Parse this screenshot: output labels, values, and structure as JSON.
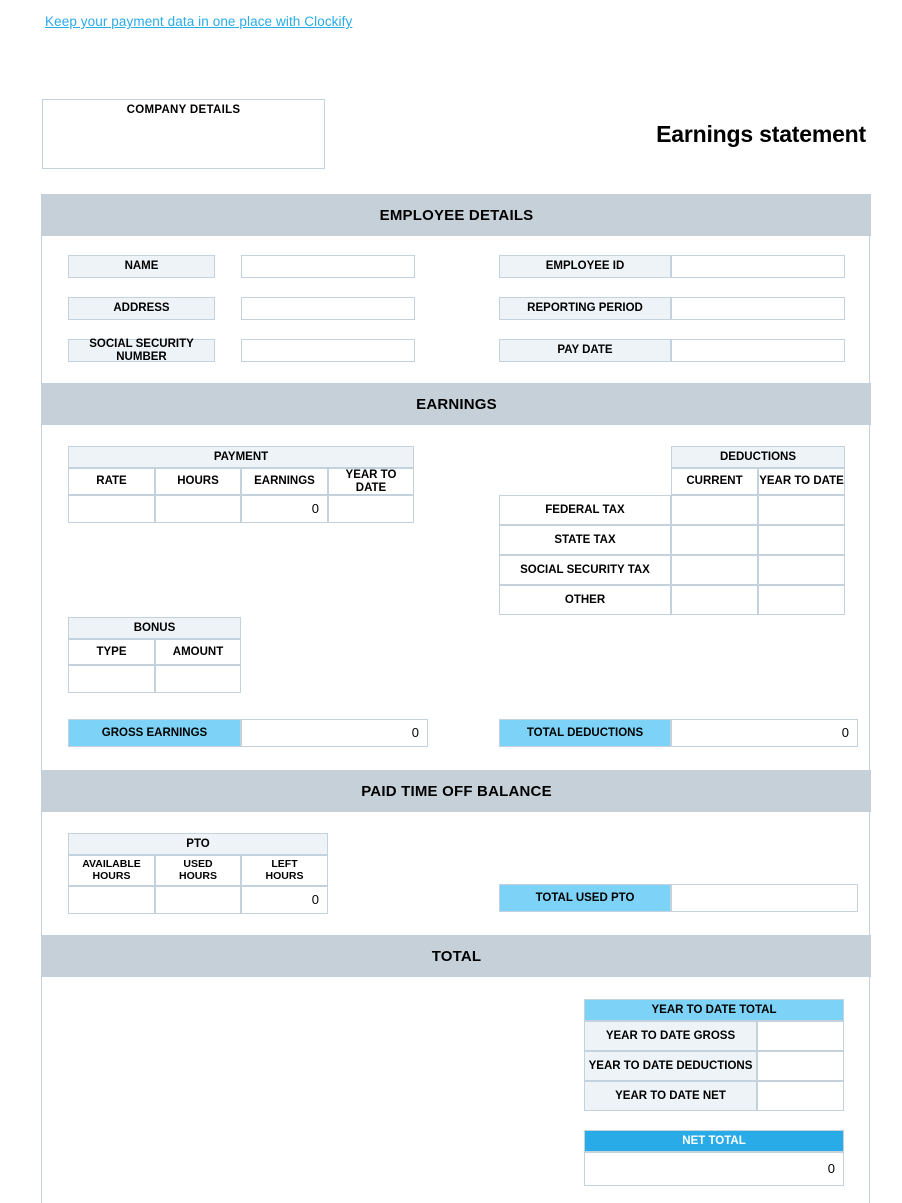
{
  "promo": {
    "link_text": "Keep your payment data in one place with Clockify"
  },
  "header": {
    "company_details_label": "COMPANY DETAILS",
    "title": "Earnings statement"
  },
  "colors": {
    "band": "#c5d0d8",
    "label_fill": "#edf3f7",
    "accent_light": "#7dd3f7",
    "accent_strong": "#29abe8",
    "link": "#29abe8",
    "border": "#c3d2dc"
  },
  "sections": {
    "employee_details": "EMPLOYEE DETAILS",
    "earnings": "EARNINGS",
    "pto_balance": "PAID TIME OFF BALANCE",
    "total": "TOTAL"
  },
  "employee_details": {
    "left_fields": [
      {
        "label": "NAME",
        "value": ""
      },
      {
        "label": "ADDRESS",
        "value": ""
      },
      {
        "label": "SOCIAL SECURITY NUMBER",
        "value": ""
      }
    ],
    "right_fields": [
      {
        "label": "EMPLOYEE ID",
        "value": ""
      },
      {
        "label": "REPORTING PERIOD",
        "value": ""
      },
      {
        "label": "PAY DATE",
        "value": ""
      }
    ]
  },
  "payment_table": {
    "title": "PAYMENT",
    "columns": [
      "RATE",
      "HOURS",
      "EARNINGS",
      "YEAR TO DATE"
    ],
    "rows": [
      {
        "rate": "",
        "hours": "",
        "earnings": "0",
        "year_to_date": ""
      }
    ]
  },
  "deductions_table": {
    "title": "DEDUCTIONS",
    "columns": [
      "CURRENT",
      "YEAR TO DATE"
    ],
    "rows": [
      {
        "label": "FEDERAL TAX",
        "current": "",
        "year_to_date": ""
      },
      {
        "label": "STATE TAX",
        "current": "",
        "year_to_date": ""
      },
      {
        "label": "SOCIAL SECURITY TAX",
        "current": "",
        "year_to_date": ""
      },
      {
        "label": "OTHER",
        "current": "",
        "year_to_date": ""
      }
    ]
  },
  "bonus_table": {
    "title": "BONUS",
    "columns": [
      "TYPE",
      "AMOUNT"
    ],
    "rows": [
      {
        "type": "",
        "amount": ""
      }
    ]
  },
  "gross_earnings": {
    "label": "GROSS EARNINGS",
    "value": "0"
  },
  "total_deductions": {
    "label": "TOTAL DEDUCTIONS",
    "value": "0"
  },
  "pto_table": {
    "title": "PTO",
    "columns": [
      "AVAILABLE HOURS",
      "USED HOURS",
      "LEFT HOURS"
    ],
    "columns_line1": [
      "AVAILABLE",
      "USED",
      "LEFT"
    ],
    "columns_line2": [
      "HOURS",
      "HOURS",
      "HOURS"
    ],
    "rows": [
      {
        "available_hours": "",
        "used_hours": "",
        "left_hours": "0"
      }
    ]
  },
  "total_used_pto": {
    "label": "TOTAL USED PTO",
    "value": ""
  },
  "year_to_date_total": {
    "title": "YEAR TO DATE TOTAL",
    "rows": [
      {
        "label": "YEAR TO DATE GROSS",
        "value": ""
      },
      {
        "label": "YEAR TO DATE DEDUCTIONS",
        "value": ""
      },
      {
        "label": "YEAR TO DATE NET",
        "value": ""
      }
    ]
  },
  "net_total": {
    "label": "NET TOTAL",
    "value": "0"
  }
}
